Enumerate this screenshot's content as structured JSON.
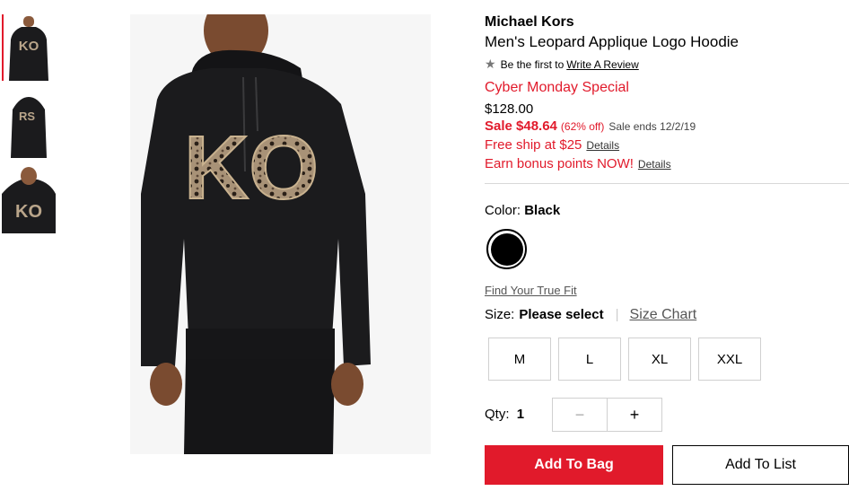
{
  "gallery": {
    "thumbnails": [
      {
        "alt": "front view",
        "letters": "KO"
      },
      {
        "alt": "back view",
        "letters": "RS"
      },
      {
        "alt": "detail view",
        "letters": "KO"
      }
    ],
    "main_image_letters": "KO"
  },
  "product": {
    "brand": "Michael Kors",
    "title": "Men's Leopard Applique Logo Hoodie",
    "review_prefix": "Be the first to",
    "review_link": "Write A Review",
    "promo": "Cyber Monday Special",
    "original_price": "$128.00",
    "sale_price": "Sale $48.64",
    "discount": "(62% off)",
    "sale_ends": "Sale ends 12/2/19",
    "offers": [
      {
        "text": "Free ship at $25",
        "link": "Details"
      },
      {
        "text": "Earn bonus points NOW!",
        "link": "Details"
      }
    ]
  },
  "color": {
    "label": "Color:",
    "selected": "Black",
    "swatch_hex": "#000000"
  },
  "fit": {
    "link": "Find Your True Fit"
  },
  "size": {
    "label": "Size:",
    "selected": "Please select",
    "chart_link": "Size Chart",
    "options": [
      "M",
      "L",
      "XL",
      "XXL"
    ]
  },
  "quantity": {
    "label": "Qty:",
    "value": "1",
    "minus": "−",
    "plus": "+"
  },
  "actions": {
    "add_to_bag": "Add To Bag",
    "add_to_list": "Add To List"
  },
  "colors": {
    "accent_red": "#e11a2b",
    "garment": "#1b1b1d"
  }
}
